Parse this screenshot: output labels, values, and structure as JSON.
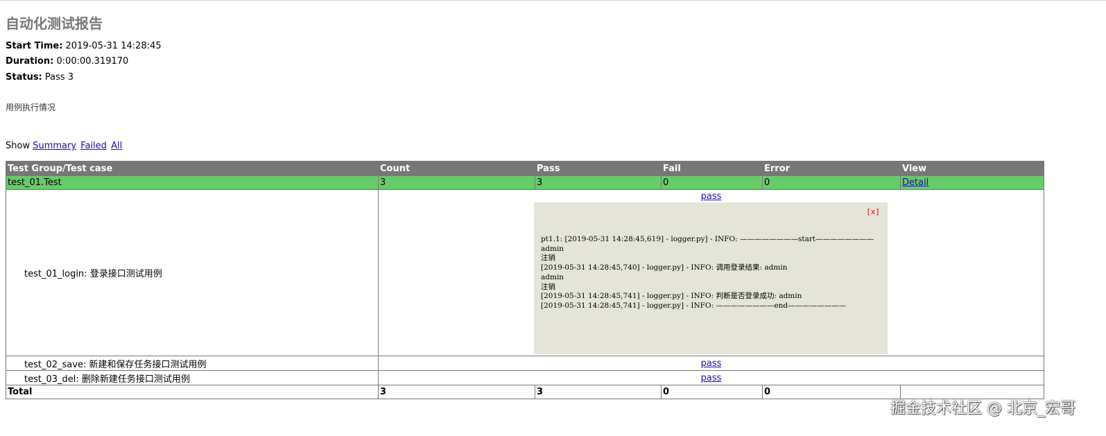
{
  "report": {
    "title": "自动化测试报告",
    "start_time_label": "Start Time:",
    "start_time": "2019-05-31 14:28:45",
    "duration_label": "Duration:",
    "duration": "0:00:00.319170",
    "status_label": "Status:",
    "status": "Pass 3",
    "description": "用例执行情况"
  },
  "filter": {
    "label": "Show",
    "summary": "Summary",
    "failed": "Failed",
    "all": "All"
  },
  "table": {
    "headers": [
      "Test Group/Test case",
      "Count",
      "Pass",
      "Fail",
      "Error",
      "View"
    ],
    "class_row": {
      "name": "test_01.Test",
      "count": "3",
      "pass": "3",
      "fail": "0",
      "error": "0",
      "view": "Detail"
    },
    "cases": [
      {
        "name": "test_01_login: 登录接口测试用例",
        "result": "pass"
      },
      {
        "name": "test_02_save: 新建和保存任务接口测试用例",
        "result": "pass"
      },
      {
        "name": "test_03_del: 删除新建任务接口测试用例",
        "result": "pass"
      }
    ],
    "total": {
      "label": "Total",
      "count": "3",
      "pass": "3",
      "fail": "0",
      "error": "0"
    }
  },
  "popup": {
    "close": "[x]",
    "log_lines": [
      "pt1.1: [2019-05-31 14:28:45,619] - logger.py] - INFO: ————————start————————",
      "admin",
      "注销",
      "[2019-05-31 14:28:45,740] - logger.py] - INFO: 调用登录结果: admin",
      "admin",
      "注销",
      "[2019-05-31 14:28:45,741] - logger.py] - INFO: 判断是否登录成功: admin",
      "[2019-05-31 14:28:45,741] - logger.py] - INFO: ————————end————————"
    ]
  },
  "watermark": "掘金技术社区 @ 北京_宏哥"
}
